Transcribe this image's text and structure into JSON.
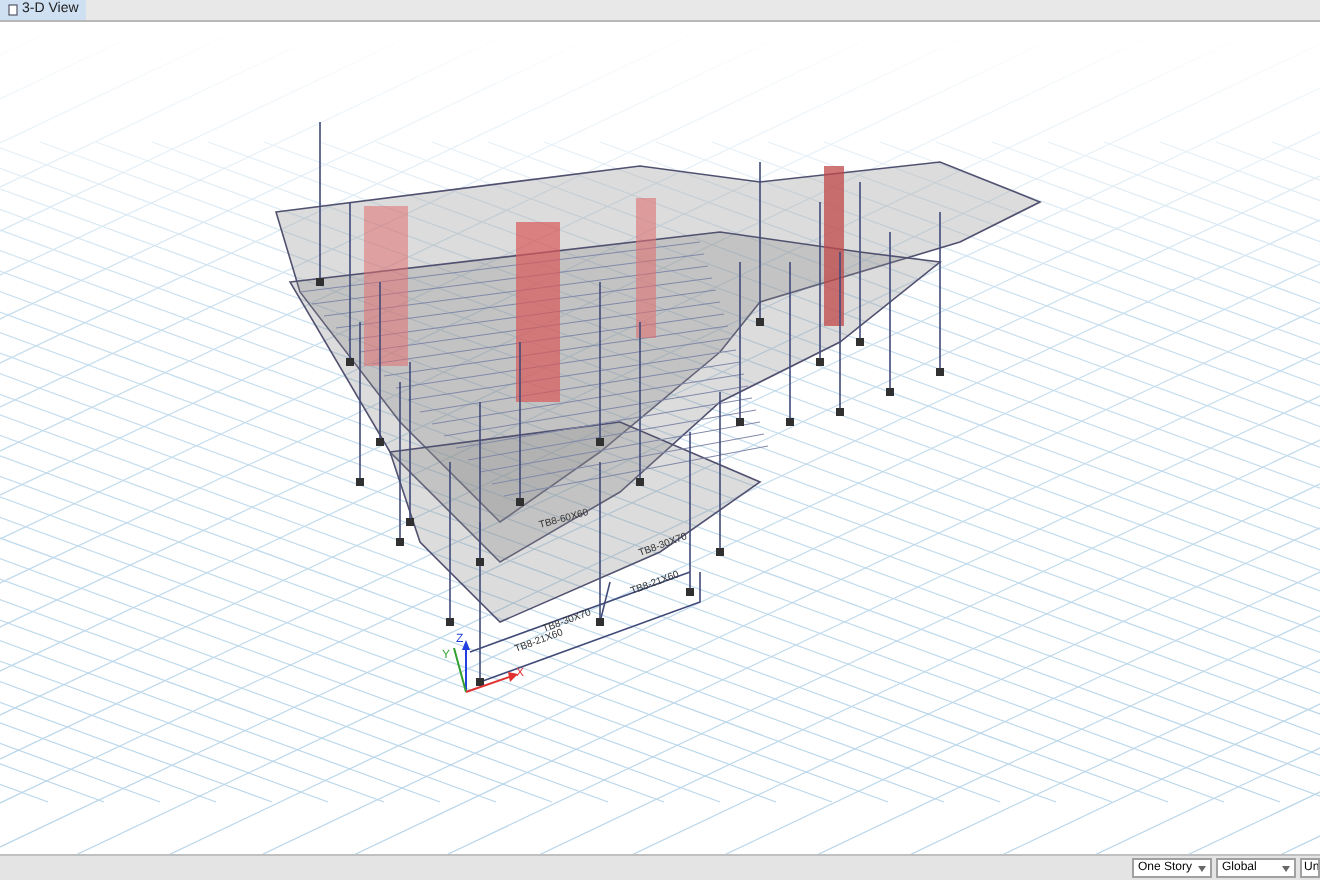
{
  "tab": {
    "label": "3-D View",
    "selected": true
  },
  "model_labels": [
    {
      "text": "TB8-60X60"
    },
    {
      "text": "TB8-30X70"
    },
    {
      "text": "TB8-30X70"
    },
    {
      "text": "TB8-21X60"
    },
    {
      "text": "TB8-21X60"
    }
  ],
  "axes": {
    "x": "X",
    "y": "Y",
    "z": "Z"
  },
  "status_bar": {
    "story_mode": "One Story",
    "coordinate_system": "Global",
    "units": "Un"
  }
}
